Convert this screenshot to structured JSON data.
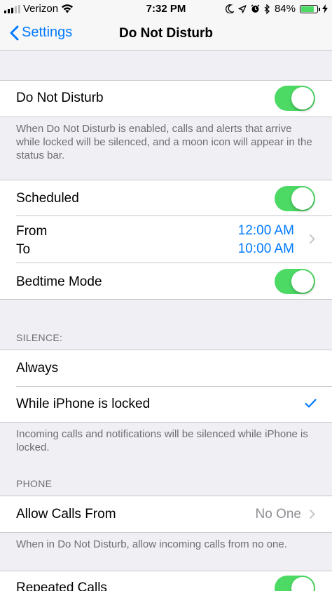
{
  "status_bar": {
    "carrier": "Verizon",
    "time": "7:32 PM",
    "battery": "84%",
    "battery_level": 0.84,
    "icons": [
      "signal-icon",
      "wifi-icon",
      "moon-icon",
      "location-icon",
      "alarm-icon",
      "bluetooth-icon",
      "battery-icon",
      "charging-icon"
    ]
  },
  "nav": {
    "back_label": "Settings",
    "title": "Do Not Disturb"
  },
  "dnd": {
    "label": "Do Not Disturb",
    "enabled": true,
    "footer": "When Do Not Disturb is enabled, calls and alerts that arrive while locked will be silenced, and a moon icon will appear in the status bar."
  },
  "schedule": {
    "scheduled_label": "Scheduled",
    "scheduled_enabled": true,
    "from_label": "From",
    "to_label": "To",
    "from_value": "12:00 AM",
    "to_value": "10:00 AM",
    "bedtime_label": "Bedtime Mode",
    "bedtime_enabled": true
  },
  "silence": {
    "header": "SILENCE:",
    "options": [
      "Always",
      "While iPhone is locked"
    ],
    "selected": "While iPhone is locked",
    "footer": "Incoming calls and notifications will be silenced while iPhone is locked."
  },
  "phone": {
    "header": "PHONE",
    "allow_calls_label": "Allow Calls From",
    "allow_calls_value": "No One",
    "footer": "When in Do Not Disturb, allow incoming calls from no one.",
    "repeated_calls_label": "Repeated Calls",
    "repeated_calls_enabled": true
  },
  "colors": {
    "accent": "#007aff",
    "toggle_on": "#4cd964",
    "background": "#efeff4",
    "secondary_text": "#6d6d72",
    "separator": "#c8c7cc"
  }
}
